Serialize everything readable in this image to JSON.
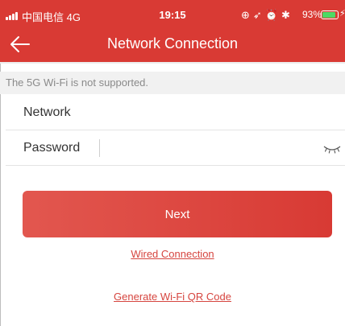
{
  "status_bar": {
    "carrier": "中国电信",
    "network": "4G",
    "time": "19:15",
    "icons": [
      "screen-rotation-lock-icon",
      "location-icon",
      "alarm-icon",
      "bluetooth-icon"
    ],
    "icon_glyphs": "⊕➶⏰✱",
    "battery_percent": "93%",
    "battery_level": 0.93
  },
  "nav": {
    "title": "Network Connection",
    "back_icon": "arrow-left-icon"
  },
  "notice": "The 5G Wi-Fi is not supported.",
  "form": {
    "network_label": "Network",
    "network_value": "",
    "password_label": "Password",
    "password_value": "",
    "password_visibility_icon": "eye-closed-icon"
  },
  "actions": {
    "next_label": "Next",
    "wired_label": "Wired Connection",
    "qr_label": "Generate Wi-Fi QR Code"
  },
  "colors": {
    "header": "#d93a34",
    "button_start": "#e2574f",
    "button_end": "#d83a34",
    "link": "#d6453f",
    "battery": "#4cd964"
  }
}
